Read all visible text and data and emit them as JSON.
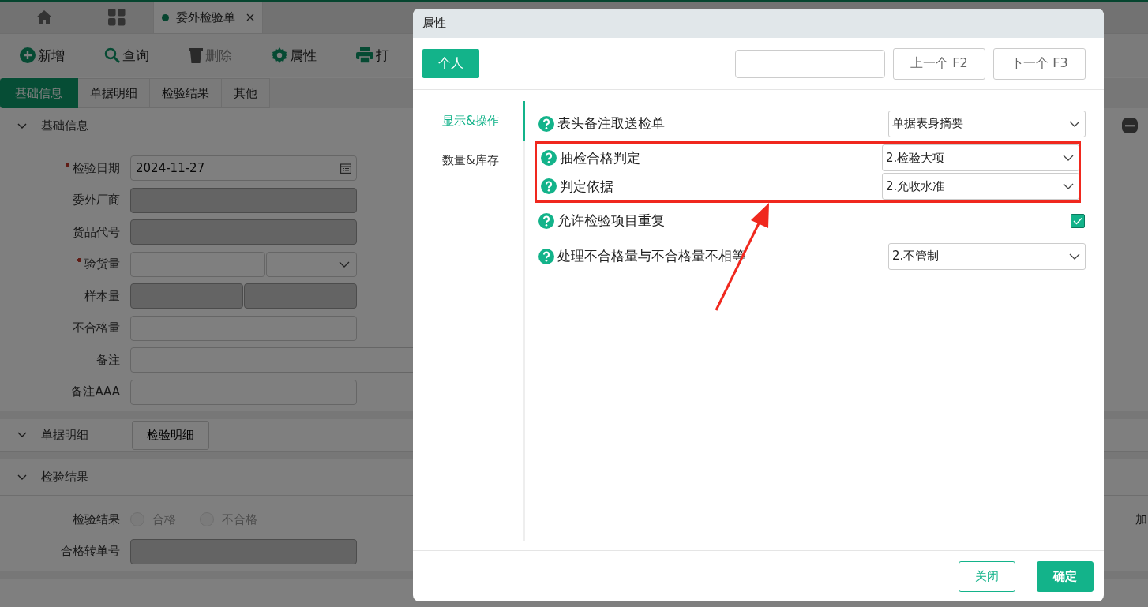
{
  "app_tabs": [
    {
      "kind": "home",
      "selected": false
    },
    {
      "kind": "grid",
      "selected": false
    },
    {
      "kind": "document",
      "label": "委外检验单",
      "selected": true
    }
  ],
  "toolbar": [
    {
      "kind": "add",
      "label": "新增",
      "disabled": false
    },
    {
      "kind": "search",
      "label": "查询",
      "disabled": false
    },
    {
      "kind": "delete",
      "label": "删除",
      "disabled": true
    },
    {
      "kind": "settings",
      "label": "属性",
      "disabled": false
    },
    {
      "kind": "print",
      "label": "打",
      "disabled": false
    }
  ],
  "section_tabs": [
    {
      "label": "基础信息",
      "selected": true
    },
    {
      "label": "单据明细",
      "selected": false
    },
    {
      "label": "检验结果",
      "selected": false
    },
    {
      "label": "其他",
      "selected": false
    }
  ],
  "basic_info": {
    "title": "基础信息",
    "fields": [
      {
        "label": "检验日期",
        "required": true,
        "kind": "date",
        "value": "2024-11-27",
        "disabled": false
      },
      {
        "label": "委外厂商",
        "required": false,
        "kind": "text",
        "disabled": true
      },
      {
        "label": "货品代号",
        "required": false,
        "kind": "text",
        "disabled": true
      },
      {
        "label": "验货量",
        "required": true,
        "kind": "number-unit",
        "disabled": false
      },
      {
        "label": "样本量",
        "required": false,
        "kind": "pair",
        "disabled": true
      },
      {
        "label": "不合格量",
        "required": false,
        "kind": "text",
        "disabled": false
      },
      {
        "label": "备注",
        "required": false,
        "kind": "wide",
        "disabled": false
      },
      {
        "label": "备注AAA",
        "required": false,
        "kind": "text",
        "disabled": false
      }
    ]
  },
  "detail": {
    "title": "单据明细",
    "button": "检验明细"
  },
  "result": {
    "title": "检验结果",
    "radio_label": "检验结果",
    "options": [
      {
        "label": "合格",
        "selected": false
      },
      {
        "label": "不合格",
        "selected": false
      }
    ],
    "transfer_label": "合格转单号",
    "side_text": "加"
  },
  "dialog": {
    "title": "属性",
    "scope_button": "个人",
    "prev_button": "上一个 F2",
    "next_button": "下一个 F3",
    "nav": [
      {
        "label": "显示&操作",
        "selected": true
      },
      {
        "label": "数量&库存",
        "selected": false
      }
    ],
    "settings": [
      {
        "label": "表头备注取送检单",
        "kind": "select",
        "value": "单据表身摘要",
        "highlighted": false
      },
      {
        "label": "抽检合格判定",
        "kind": "select",
        "value": "2.检验大项",
        "highlighted": true
      },
      {
        "label": "判定依据",
        "kind": "select",
        "value": "2.允收水准",
        "highlighted": true
      },
      {
        "label": "允许检验项目重复",
        "kind": "checkbox",
        "checked": true,
        "highlighted": false
      },
      {
        "label": "处理不合格量与不合格量不相等",
        "kind": "select",
        "value": "2.不管制",
        "highlighted": false
      }
    ],
    "footer": [
      {
        "label": "关闭",
        "kind": "secondary"
      },
      {
        "label": "确定",
        "kind": "primary"
      }
    ]
  }
}
